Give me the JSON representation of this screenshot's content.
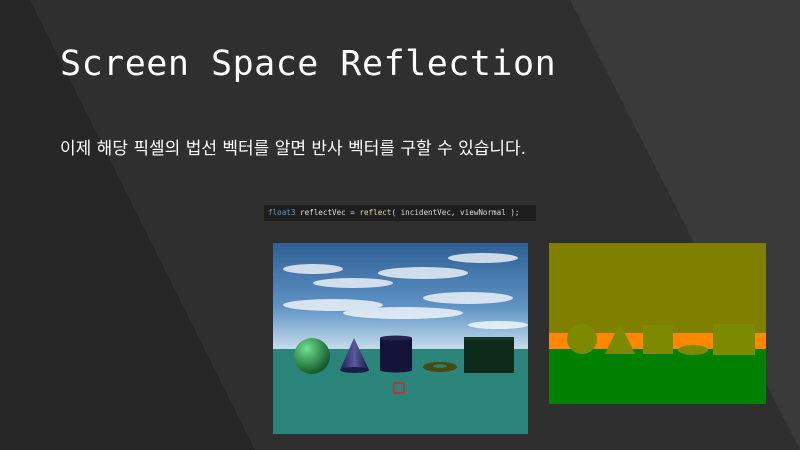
{
  "slide": {
    "title": "Screen Space Reflection",
    "subtitle": "이제 해당 픽셀의 법선 벡터를 알면 반사 벡터를 구할 수 있습니다.",
    "code": {
      "type": "float3",
      "var": " reflectVec = ",
      "func": "reflect",
      "args": "( incidentVec, viewNormal );"
    }
  },
  "colors": {
    "background": "#262626",
    "sky": "#3f78b0",
    "floor": "#2a8479",
    "normal_top": "#808000",
    "normal_band": "#ff8800",
    "normal_floor": "#008000",
    "marker": "#e02020"
  }
}
